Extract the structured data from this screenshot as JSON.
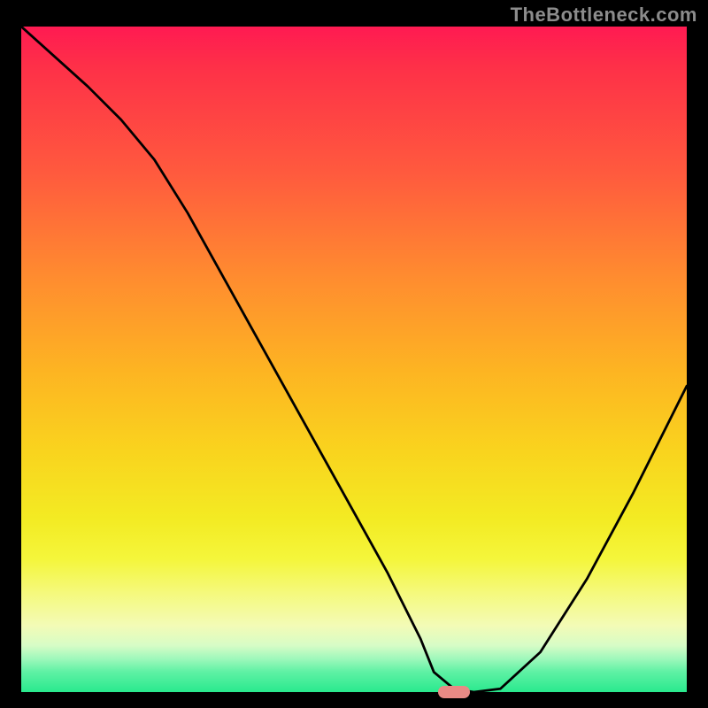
{
  "watermark": "TheBottleneck.com",
  "chart_data": {
    "type": "line",
    "title": "",
    "xlabel": "",
    "ylabel": "",
    "xlim": [
      0,
      100
    ],
    "ylim": [
      0,
      100
    ],
    "series": [
      {
        "name": "curve",
        "x": [
          0,
          10,
          15,
          20,
          25,
          30,
          35,
          40,
          45,
          50,
          55,
          60,
          62,
          65,
          68,
          72,
          78,
          85,
          92,
          100
        ],
        "y": [
          100,
          91,
          86,
          80,
          72,
          63,
          54,
          45,
          36,
          27,
          18,
          8,
          3,
          0.5,
          0,
          0.5,
          6,
          17,
          30,
          46
        ]
      }
    ],
    "marker": {
      "x_center": 65,
      "width_pct": 4.8,
      "color": "#e98a85"
    },
    "background_gradient": {
      "stops": [
        {
          "pct": 0,
          "color": "#ff1a52"
        },
        {
          "pct": 22,
          "color": "#ff5a3e"
        },
        {
          "pct": 52,
          "color": "#fdb522"
        },
        {
          "pct": 80,
          "color": "#f4f63b"
        },
        {
          "pct": 100,
          "color": "#29e98e"
        }
      ]
    }
  }
}
